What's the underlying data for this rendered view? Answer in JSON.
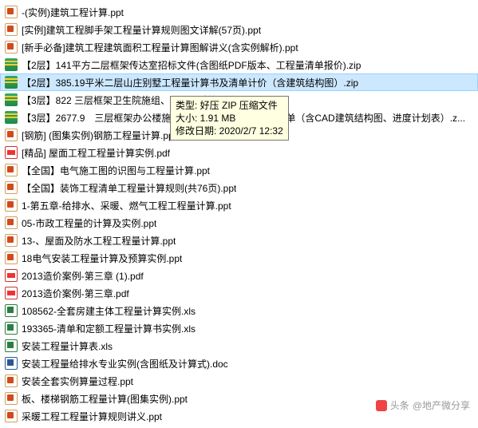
{
  "files": [
    {
      "icon": "ppt",
      "name": "-(实例)建筑工程计算.ppt",
      "selected": false
    },
    {
      "icon": "ppt",
      "name": "[实例]建筑工程脚手架工程量计算规则图文详解(57页).ppt",
      "selected": false
    },
    {
      "icon": "ppt",
      "name": "[新手必备]建筑工程建筑面积工程量计算图解讲义(含实例解析).ppt",
      "selected": false
    },
    {
      "icon": "zip",
      "name": "【2层】141平方二层框架传达室招标文件(含图纸PDF版本、工程量清单报价).zip",
      "selected": false
    },
    {
      "icon": "zip",
      "name": "【2层】385.19平米二层山庄别墅工程量计算书及清单计价（含建筑结构图）.zip",
      "selected": true
    },
    {
      "icon": "zip",
      "name": "【3层】822   三层框架卫生院施组、工程量计算（含CAD）.zip",
      "selected": false
    },
    {
      "icon": "zip",
      "name": "【3层】2677.9　三层框架办公楼施工组织设计及报价工程量清单（含CAD建筑结构图、进度计划表）.z...",
      "selected": false
    },
    {
      "icon": "ppt",
      "name": "[钢筋] (图集实例)钢筋工程量计算.ppt",
      "selected": false
    },
    {
      "icon": "pdf",
      "name": "[精品] 屋面工程工程量计算实例.pdf",
      "selected": false
    },
    {
      "icon": "ppt",
      "name": "【全国】电气施工图的识图与工程量计算.ppt",
      "selected": false
    },
    {
      "icon": "ppt",
      "name": "【全国】装饰工程清单工程量计算规则(共76页).ppt",
      "selected": false
    },
    {
      "icon": "ppt",
      "name": "1-第五章-给排水、采暖、燃气工程工程量计算.ppt",
      "selected": false
    },
    {
      "icon": "ppt",
      "name": "05-市政工程量的计算及实例.ppt",
      "selected": false
    },
    {
      "icon": "ppt",
      "name": "13-、屋面及防水工程工程量计算.ppt",
      "selected": false
    },
    {
      "icon": "ppt",
      "name": "18电气安装工程量计算及预算实例.ppt",
      "selected": false
    },
    {
      "icon": "pdf",
      "name": "2013造价案例-第三章 (1).pdf",
      "selected": false
    },
    {
      "icon": "pdf",
      "name": "2013造价案例-第三章.pdf",
      "selected": false
    },
    {
      "icon": "xls",
      "name": "108562-全套房建主体工程量计算实例.xls",
      "selected": false
    },
    {
      "icon": "xls",
      "name": "193365-清单和定额工程量计算书实例.xls",
      "selected": false
    },
    {
      "icon": "xls",
      "name": "安装工程量计算表.xls",
      "selected": false
    },
    {
      "icon": "doc",
      "name": "安装工程量给排水专业实例(含图纸及计算式).doc",
      "selected": false
    },
    {
      "icon": "ppt",
      "name": "安装全套实例算量过程.ppt",
      "selected": false
    },
    {
      "icon": "ppt",
      "name": "板、楼梯钢筋工程量计算(图集实例).ppt",
      "selected": false
    },
    {
      "icon": "ppt",
      "name": "采暖工程工程量计算规则讲义.ppt",
      "selected": false
    }
  ],
  "tooltip": {
    "type_label": "类型: ",
    "type_value": "好压 ZIP 压缩文件",
    "size_label": "大小: ",
    "size_value": "1.91 MB",
    "date_label": "修改日期: ",
    "date_value": "2020/2/7 12:32"
  },
  "watermark": {
    "prefix": "头条",
    "handle": "@地产微分享"
  }
}
